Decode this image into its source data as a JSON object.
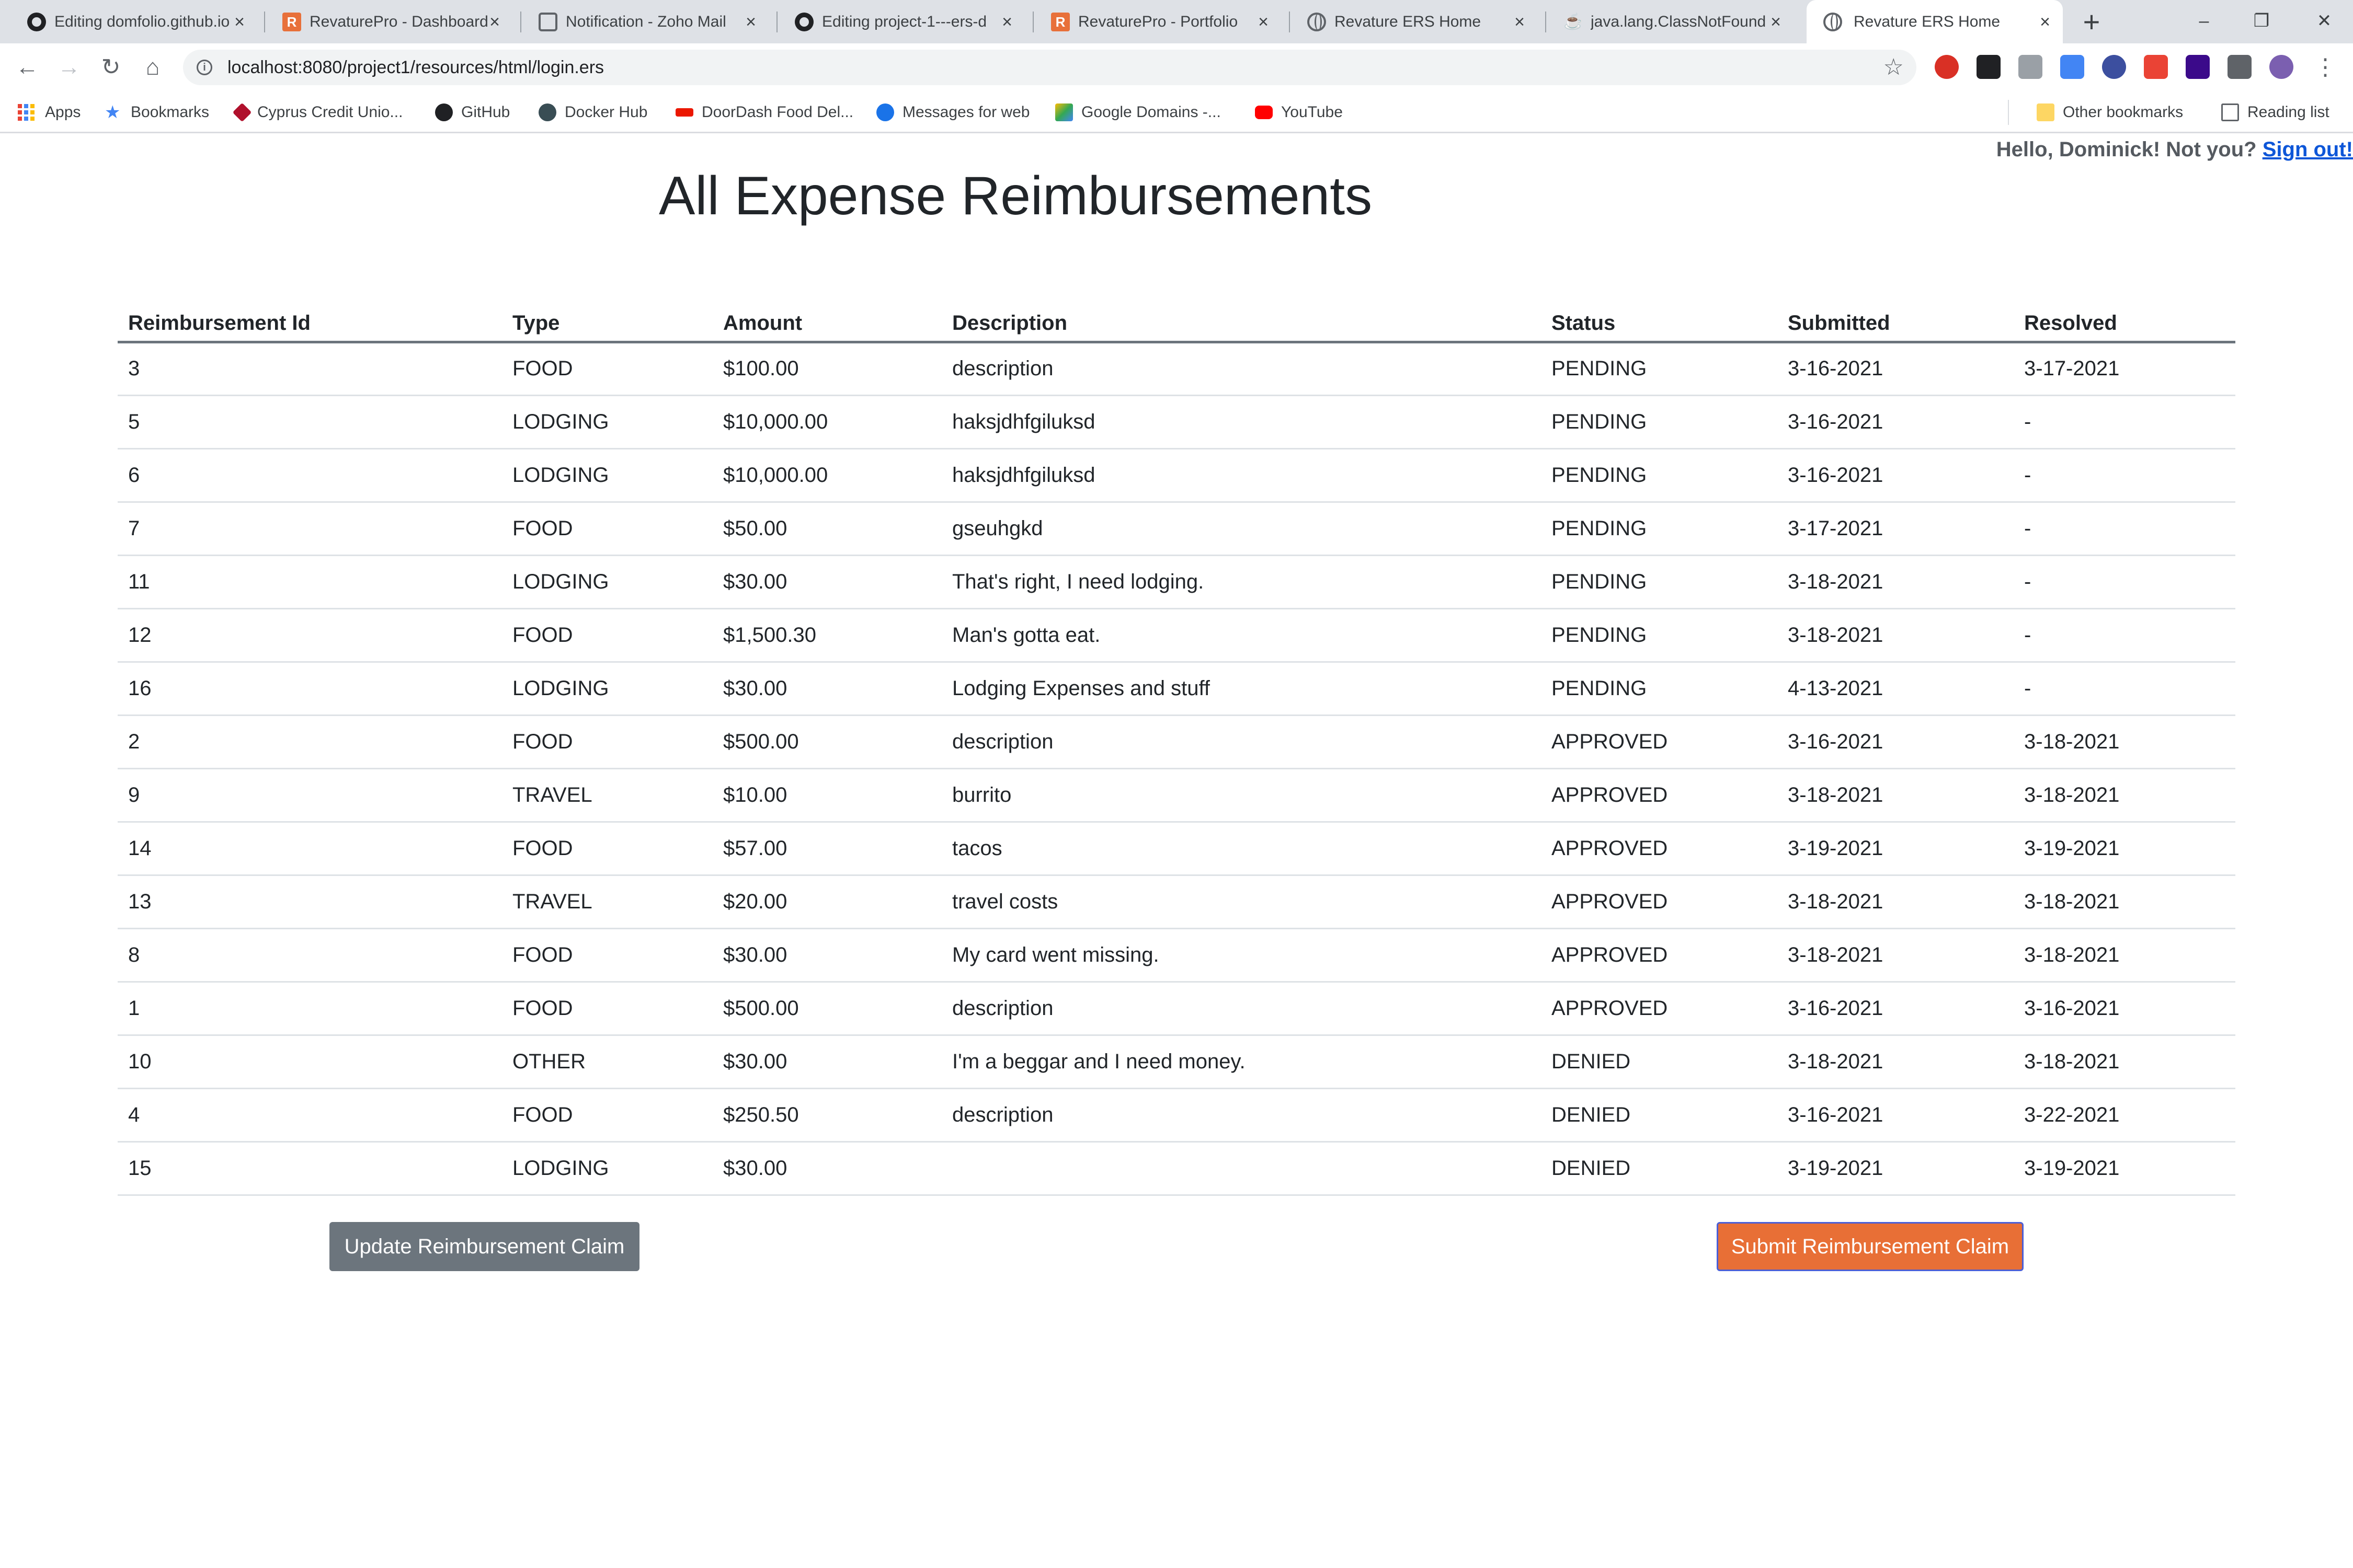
{
  "browser": {
    "tabs": [
      {
        "title": "Editing domfolio.github.io",
        "icon": "github-icon"
      },
      {
        "title": "RevaturePro - Dashboard",
        "icon": "revature-icon"
      },
      {
        "title": "Notification - Zoho Mail",
        "icon": "zoho-icon"
      },
      {
        "title": "Editing project-1---ers-d",
        "icon": "github-icon"
      },
      {
        "title": "RevaturePro - Portfolio",
        "icon": "revature-icon"
      },
      {
        "title": "Revature ERS Home",
        "icon": "globe-icon"
      },
      {
        "title": "java.lang.ClassNotFound",
        "icon": "java-icon"
      },
      {
        "title": "Revature ERS Home",
        "icon": "globe-icon",
        "active": true
      }
    ],
    "url": "localhost:8080/project1/resources/html/login.ers",
    "bookmarks": [
      {
        "label": "Apps"
      },
      {
        "label": "Bookmarks"
      },
      {
        "label": "Cyprus Credit Unio..."
      },
      {
        "label": "GitHub"
      },
      {
        "label": "Docker Hub"
      },
      {
        "label": "DoorDash Food Del..."
      },
      {
        "label": "Messages for web"
      },
      {
        "label": "Google Domains -..."
      },
      {
        "label": "YouTube"
      }
    ],
    "other_bookmarks": "Other bookmarks",
    "reading_list": "Reading list"
  },
  "header": {
    "greeting": "Hello, Dominick! Not you?",
    "sign_out": "Sign out!"
  },
  "main": {
    "title": "All Expense Reimbursements",
    "columns": [
      "Reimbursement Id",
      "Type",
      "Amount",
      "Description",
      "Status",
      "Submitted",
      "Resolved"
    ],
    "rows": [
      [
        "3",
        "FOOD",
        "$100.00",
        "description",
        "PENDING",
        "3-16-2021",
        "3-17-2021"
      ],
      [
        "5",
        "LODGING",
        "$10,000.00",
        "haksjdhfgiluksd",
        "PENDING",
        "3-16-2021",
        "-"
      ],
      [
        "6",
        "LODGING",
        "$10,000.00",
        "haksjdhfgiluksd",
        "PENDING",
        "3-16-2021",
        "-"
      ],
      [
        "7",
        "FOOD",
        "$50.00",
        "gseuhgkd",
        "PENDING",
        "3-17-2021",
        "-"
      ],
      [
        "11",
        "LODGING",
        "$30.00",
        "That's right, I need lodging.",
        "PENDING",
        "3-18-2021",
        "-"
      ],
      [
        "12",
        "FOOD",
        "$1,500.30",
        "Man's gotta eat.",
        "PENDING",
        "3-18-2021",
        "-"
      ],
      [
        "16",
        "LODGING",
        "$30.00",
        "Lodging Expenses and stuff",
        "PENDING",
        "4-13-2021",
        "-"
      ],
      [
        "2",
        "FOOD",
        "$500.00",
        "description",
        "APPROVED",
        "3-16-2021",
        "3-18-2021"
      ],
      [
        "9",
        "TRAVEL",
        "$10.00",
        "burrito",
        "APPROVED",
        "3-18-2021",
        "3-18-2021"
      ],
      [
        "14",
        "FOOD",
        "$57.00",
        "tacos",
        "APPROVED",
        "3-19-2021",
        "3-19-2021"
      ],
      [
        "13",
        "TRAVEL",
        "$20.00",
        "travel costs",
        "APPROVED",
        "3-18-2021",
        "3-18-2021"
      ],
      [
        "8",
        "FOOD",
        "$30.00",
        "My card went missing.",
        "APPROVED",
        "3-18-2021",
        "3-18-2021"
      ],
      [
        "1",
        "FOOD",
        "$500.00",
        "description",
        "APPROVED",
        "3-16-2021",
        "3-16-2021"
      ],
      [
        "10",
        "OTHER",
        "$30.00",
        "I'm a beggar and I need money.",
        "DENIED",
        "3-18-2021",
        "3-18-2021"
      ],
      [
        "4",
        "FOOD",
        "$250.50",
        "description",
        "DENIED",
        "3-16-2021",
        "3-22-2021"
      ],
      [
        "15",
        "LODGING",
        "$30.00",
        "",
        "DENIED",
        "3-19-2021",
        "3-19-2021"
      ]
    ],
    "update_button": "Update Reimbursement Claim",
    "submit_button": "Submit Reimbursement Claim"
  },
  "colors": {
    "update_button": "#6c757d",
    "submit_button": "#e86f36",
    "link": "#0d56d8"
  }
}
